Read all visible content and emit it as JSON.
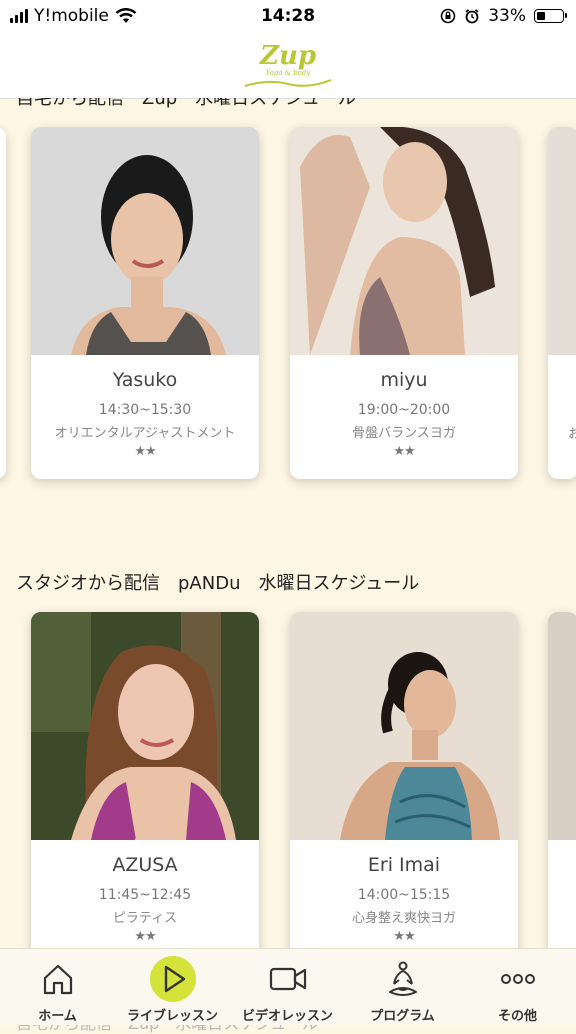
{
  "status_bar": {
    "carrier": "Y!mobile",
    "time": "14:28",
    "battery": "33%",
    "battery_level": 0.33
  },
  "header": {
    "logo_text": "Zup",
    "logo_tagline": "Yoga & body"
  },
  "sections": [
    {
      "title": "自宅から配信　Zup　水曜日スケジュール",
      "cards": [
        {
          "name": "Yasuko",
          "time": "14:30~15:30",
          "category": "オリエンタルアジャストメント",
          "stars": "★★"
        },
        {
          "name": "miyu",
          "time": "19:00~20:00",
          "category": "骨盤バランスヨガ",
          "stars": "★★"
        }
      ],
      "partial_card_text": "お"
    },
    {
      "title": "スタジオから配信　pANDu　水曜日スケジュール",
      "cards": [
        {
          "name": "AZUSA",
          "time": "11:45~12:45",
          "category": "ピラティス",
          "stars": "★★"
        },
        {
          "name": "Eri Imai",
          "time": "14:00~15:15",
          "category": "心身整え爽快ヨガ",
          "stars": "★★"
        }
      ]
    },
    {
      "title": "自宅から配信　Zup　水曜日スケジュール"
    }
  ],
  "tabbar": {
    "items": [
      {
        "label": "ホーム",
        "icon": "home-icon"
      },
      {
        "label": "ライブレッスン",
        "icon": "play-icon"
      },
      {
        "label": "ビデオレッスン",
        "icon": "video-camera-icon"
      },
      {
        "label": "プログラム",
        "icon": "meditation-icon"
      },
      {
        "label": "その他",
        "icon": "more-icon"
      }
    ],
    "active_index": 1,
    "accent_color": "#d4e23a"
  }
}
